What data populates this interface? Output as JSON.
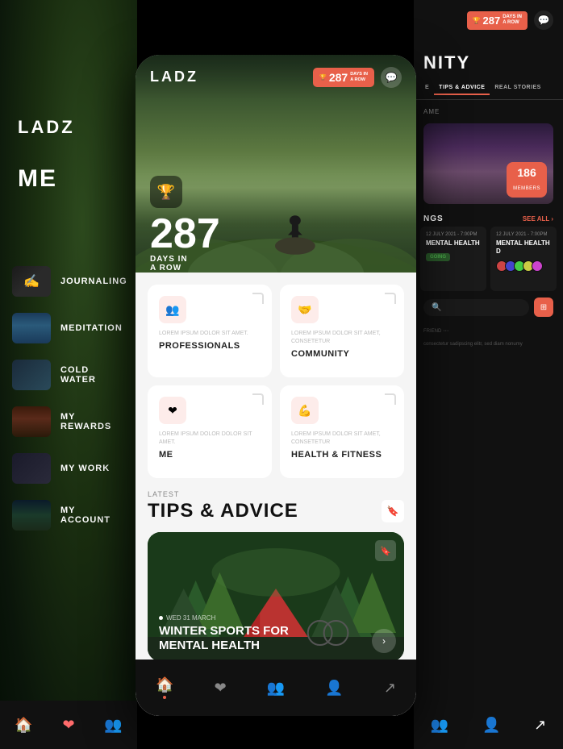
{
  "app": {
    "name": "LADZ",
    "logo": "LADZ"
  },
  "header": {
    "badge_num": "287",
    "badge_days_label": "DAYS IN\nA ROW",
    "chat_icon": "💬",
    "trophy_icon": "🏆"
  },
  "hero": {
    "days_count": "287",
    "days_label": "DAYS IN",
    "days_label2": "A ROW"
  },
  "cards": [
    {
      "id": "professionals",
      "icon": "👥",
      "desc": "LOREM IPSUM DOLOR SIT AMET.",
      "title": "PROFESSIONALS"
    },
    {
      "id": "community",
      "icon": "🤝",
      "desc": "LOREM IPSUM DOLOR SIT AMET, CONSETETUR",
      "title": "COMMUNITY"
    },
    {
      "id": "me",
      "icon": "❤",
      "desc": "LOREM IPSUM DOLOR DOLOR SIT AMET.",
      "title": "ME"
    },
    {
      "id": "health-fitness",
      "icon": "💪",
      "desc": "LOREM IPSUM DOLOR SIT AMET, CONSETETUR",
      "title": "HEALTH & FITNESS"
    }
  ],
  "tips": {
    "label": "LATEST",
    "title": "TIPS & ADVICE"
  },
  "article": {
    "date": "WED 31 MARCH",
    "title": "WINTER SPORTS FOR\nMENTAL HEALTH"
  },
  "phone_nav": [
    {
      "icon": "🏠",
      "active": true,
      "label": "home"
    },
    {
      "icon": "❤",
      "active": false,
      "label": "favorites"
    },
    {
      "icon": "👥",
      "active": false,
      "label": "community"
    },
    {
      "icon": "👤",
      "active": false,
      "label": "profile"
    },
    {
      "icon": "↗",
      "active": false,
      "label": "share"
    }
  ],
  "sidebar": {
    "logo": "LADZ",
    "me_label": "ME",
    "items": [
      {
        "id": "journaling",
        "label": "JOURNALING"
      },
      {
        "id": "meditation",
        "label": "MEDITATION"
      },
      {
        "id": "cold-water",
        "label": "COLD WATER"
      },
      {
        "id": "my-rewards",
        "label": "MY REWARDS"
      },
      {
        "id": "my-work",
        "label": "MY WORK"
      },
      {
        "id": "my-account",
        "label": "MY ACCOUNT"
      }
    ],
    "bottom_nav": [
      "🏠",
      "❤",
      "👥"
    ]
  },
  "right_panel": {
    "title": "NITY",
    "tabs": [
      "E",
      "TIPS & ADVICE",
      "REAL STORIES"
    ],
    "name_placeholder": "AME",
    "members": {
      "count": "186",
      "label": "MEMBERS"
    },
    "events_section": {
      "title": "NGS",
      "see_all": "SEE ALL"
    },
    "events": [
      {
        "date": "12 JULY 2021 - 7:00PM",
        "title": "MENTAL HEALTH",
        "status": "GOING"
      },
      {
        "date": "12 JULY 2021 - 7:00PM",
        "title": "MENTAL HEALTH D",
        "avatars": 5
      }
    ],
    "search_placeholder": "",
    "bottom_nav": [
      "👥",
      "👤",
      "↗"
    ]
  }
}
